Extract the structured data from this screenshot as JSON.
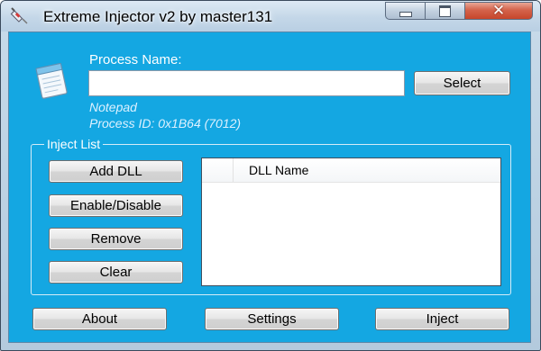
{
  "window": {
    "title": "Extreme Injector v2 by master131",
    "icons": {
      "app": "syringe-icon",
      "process": "notepad-icon"
    },
    "caption_buttons": {
      "minimize": "minimize-icon",
      "maximize": "maximize-icon",
      "close": "close-icon",
      "close_glyph": "✕"
    }
  },
  "process": {
    "label": "Process Name:",
    "input_value": "",
    "select_label": "Select",
    "name": "Notepad",
    "id_text": "Process ID: 0x1B64 (7012)"
  },
  "inject_list": {
    "legend": "Inject List",
    "buttons": {
      "add": "Add DLL",
      "enable_disable": "Enable/Disable",
      "remove": "Remove",
      "clear": "Clear"
    },
    "columns": [
      "DLL Name"
    ],
    "rows": []
  },
  "footer": {
    "about": "About",
    "settings": "Settings",
    "inject": "Inject"
  },
  "colors": {
    "client_background": "#14a7e2",
    "secondary_text": "#ddf1ff",
    "close_button": "#c7452b"
  }
}
